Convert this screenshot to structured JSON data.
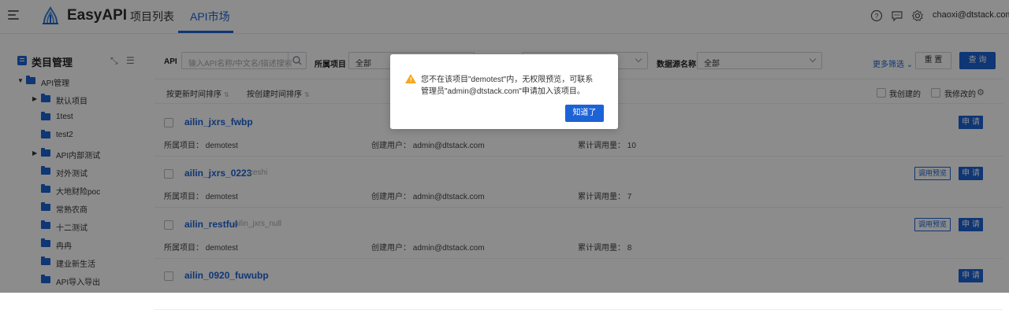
{
  "header": {
    "app_title": "EasyAPI",
    "nav": [
      "项目列表",
      "API市场"
    ],
    "active_nav": "API市场",
    "user": "chaoxi@dtstack.com",
    "icons": [
      "help-icon",
      "message-icon",
      "gear-icon"
    ]
  },
  "sidebar": {
    "title": "类目管理",
    "tree": [
      {
        "label": "API管理",
        "level": 0,
        "expanded": true
      },
      {
        "label": "默认项目",
        "level": 1,
        "has_children": true
      },
      {
        "label": "1test",
        "level": 1
      },
      {
        "label": "test2",
        "level": 1
      },
      {
        "label": "API内部测试",
        "level": 1,
        "has_children": true
      },
      {
        "label": "对外测试",
        "level": 1
      },
      {
        "label": "大地财险poc",
        "level": 1
      },
      {
        "label": "常熟农商",
        "level": 1
      },
      {
        "label": "十二测试",
        "level": 1
      },
      {
        "label": "冉冉",
        "level": 1
      },
      {
        "label": "建业新生活",
        "level": 1
      },
      {
        "label": "API导入导出",
        "level": 1
      }
    ]
  },
  "filters": {
    "api_label": "API",
    "api_placeholder": "输入API名称/中文名/描述搜索",
    "project_label": "所属项目",
    "project_value": "全部",
    "datasource_label": "数据源名称",
    "datasource_value": "全部",
    "more": "更多筛选",
    "reset": "重 置",
    "query": "查 询"
  },
  "sort_bar": {
    "sort_update": "按更新时间排序",
    "sort_create": "按创建时间排序",
    "mine_created": "我创建的",
    "mine_modified": "我修改的"
  },
  "cards": [
    {
      "name": "ailin_jxrs_fwbp",
      "sub": "",
      "project_label": "所属项目：",
      "project": "demotest",
      "creator_label": "创建用户：",
      "creator": "admin@dtstack.com",
      "calls_label": "累计调用量：",
      "calls": "10",
      "preview": false,
      "apply": "申 请"
    },
    {
      "name": "ailin_jxrs_0223",
      "sub": "ceshi",
      "project_label": "所属项目：",
      "project": "demotest",
      "creator_label": "创建用户：",
      "creator": "admin@dtstack.com",
      "calls_label": "累计调用量：",
      "calls": "7",
      "preview": true,
      "preview_label": "调用预览",
      "apply": "申 请"
    },
    {
      "name": "ailin_restful",
      "sub": "ailin_jxrs_null",
      "project_label": "所属项目：",
      "project": "demotest",
      "creator_label": "创建用户：",
      "creator": "admin@dtstack.com",
      "calls_label": "累计调用量：",
      "calls": "8",
      "preview": true,
      "preview_label": "调用预览",
      "apply": "申 请"
    },
    {
      "name": "ailin_0920_fuwubp",
      "sub": "",
      "preview": false,
      "apply": "申 请"
    }
  ],
  "modal": {
    "message": "您不在该项目\"demotest\"内，无权限预览，可联系管理员\"admin@dtstack.com\"申请加入该项目。",
    "ok": "知道了"
  }
}
